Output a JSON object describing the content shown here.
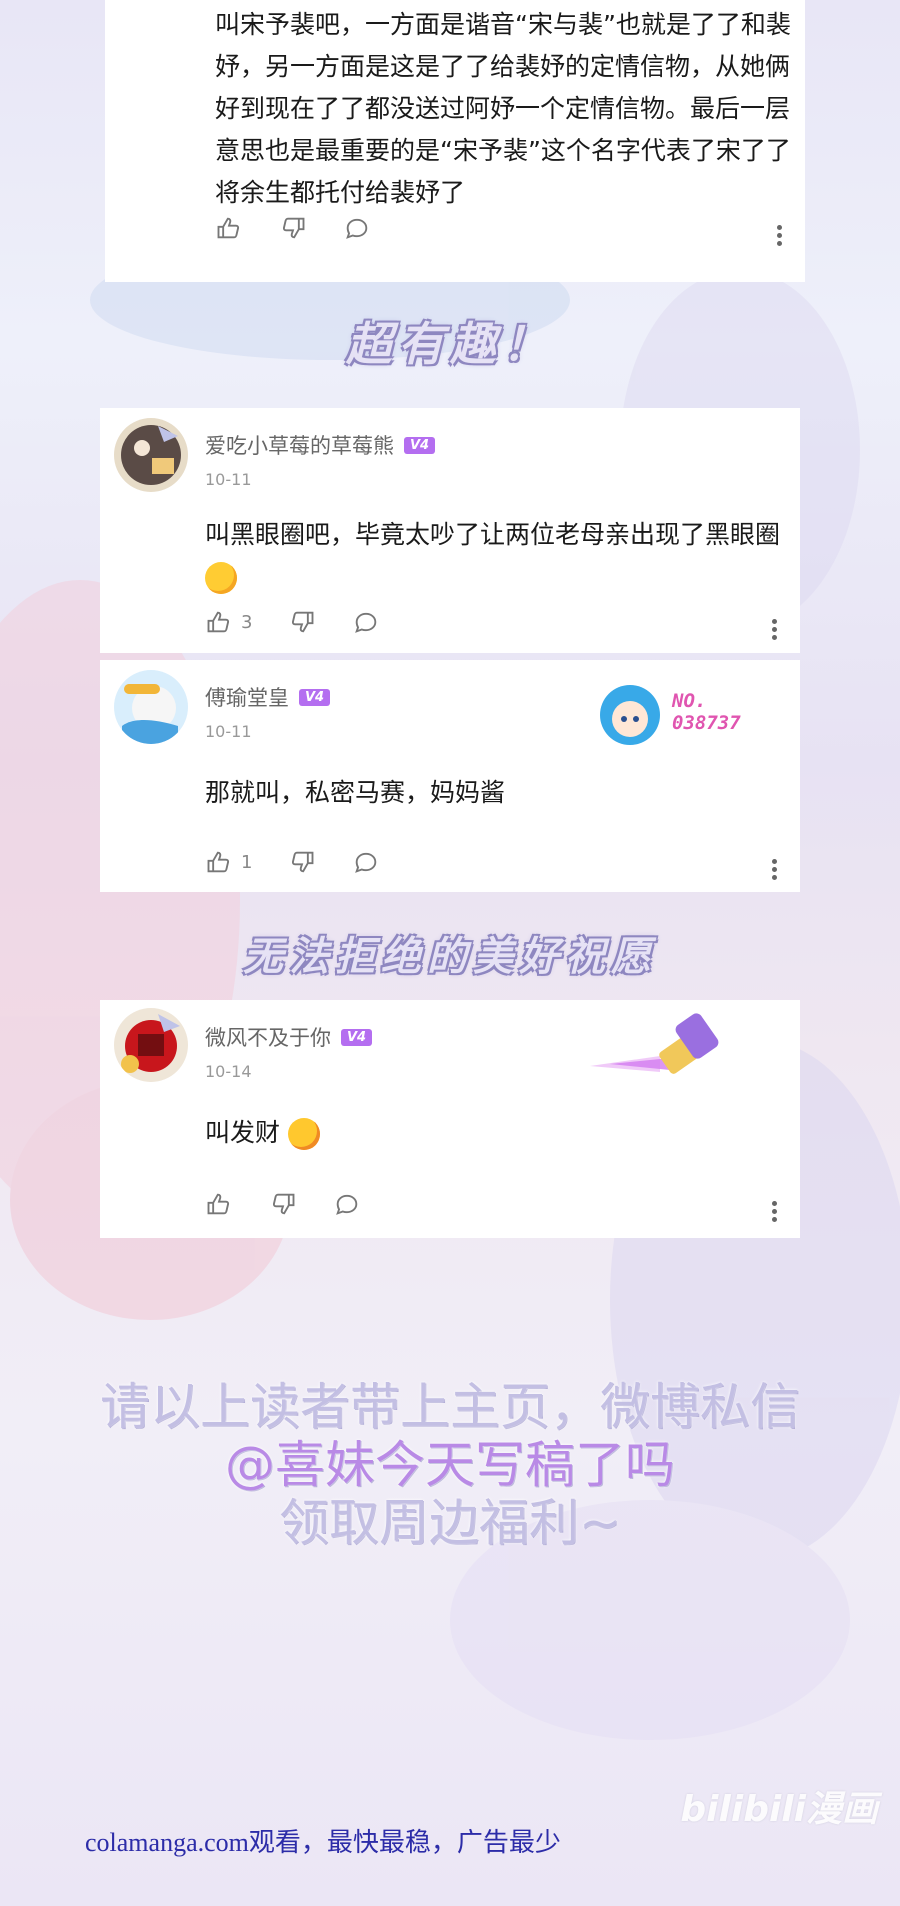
{
  "comments": [
    {
      "text": "叫宋予裴吧，一方面是谐音“宋与裴”也就是了了和裴妤，另一方面是这是了了给裴妤的定情信物，从她俩好到现在了了都没送过阿妤一个定情信物。最后一层意思也是最重要的是“宋予裴”这个名字代表了宋了了将余生都托付给裴妤了",
      "likes": ""
    },
    {
      "username": "爱吃小草莓的草莓熊",
      "level": "V4",
      "date": "10-11",
      "text": "叫黑眼圈吧，毕竟太吵了让两位老母亲出现了黑眼圈",
      "likes": "3"
    },
    {
      "username": "傅瑜堂皇",
      "level": "V4",
      "date": "10-11",
      "text": "那就叫，私密马赛，妈妈酱",
      "likes": "1",
      "badge_no": "NO.\n038737"
    },
    {
      "username": "微风不及于你",
      "level": "V4",
      "date": "10-14",
      "text": "叫发财",
      "likes": ""
    }
  ],
  "banners": {
    "first": "超有趣！",
    "second": "无法拒绝的美好祝愿"
  },
  "promo": {
    "line1": "请以上读者带上主页，微博私信",
    "line2": "@喜妹今天写稿了吗",
    "line3": "领取周边福利~"
  },
  "watermark": "bilibili漫画",
  "footer": "colamanga.com观看，最快最稳，广告最少",
  "icons": {
    "like": "thumbs-up-icon",
    "dislike": "thumbs-down-icon",
    "reply": "comment-bubble-icon",
    "more": "more-vertical-icon"
  },
  "colors": {
    "vip_badge": "#b46ef0",
    "footer_text": "#2c2ca8"
  }
}
